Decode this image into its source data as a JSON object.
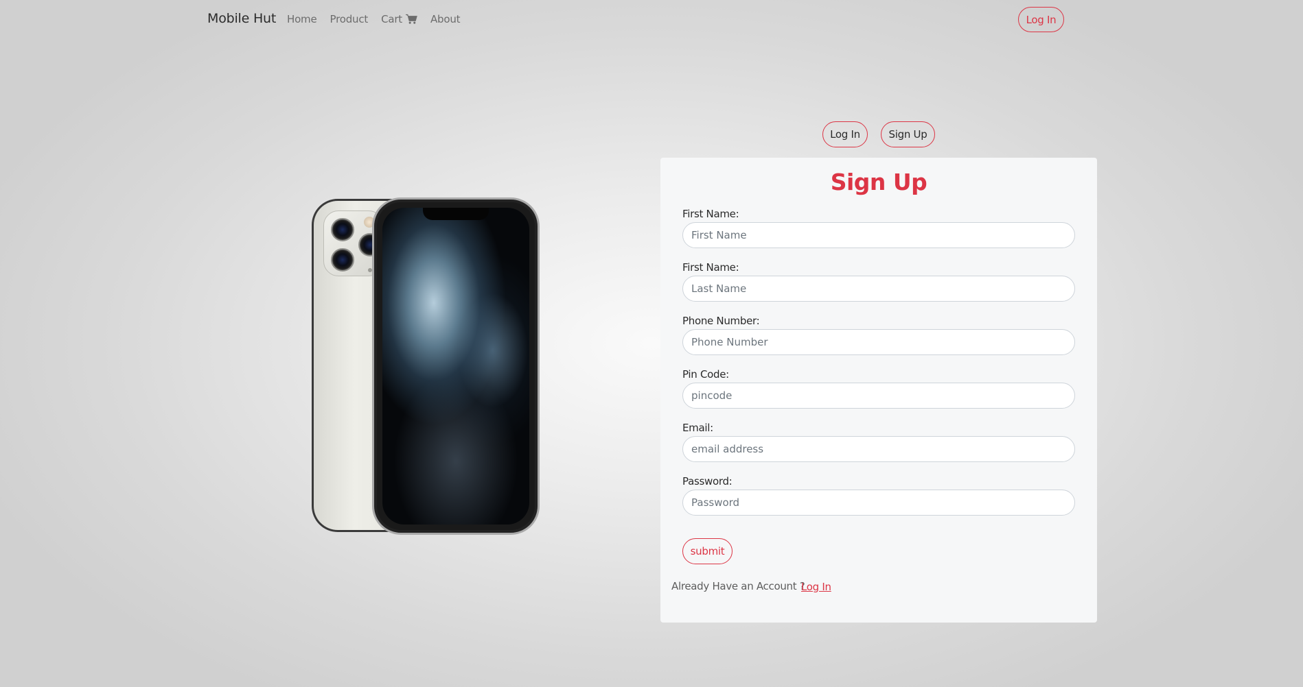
{
  "navbar": {
    "brand": "Mobile Hut",
    "links": [
      "Home",
      "Product",
      "Cart",
      "About"
    ],
    "login_label": "Log In"
  },
  "toggle": {
    "login_label": "Log In",
    "signup_label": "Sign Up"
  },
  "form": {
    "title": "Sign Up",
    "fields": [
      {
        "label": "First Name:",
        "placeholder": "First Name",
        "value": ""
      },
      {
        "label": "First Name:",
        "placeholder": "Last Name",
        "value": ""
      },
      {
        "label": "Phone Number:",
        "placeholder": "Phone Number",
        "value": ""
      },
      {
        "label": "Pin Code:",
        "placeholder": "pincode",
        "value": ""
      },
      {
        "label": "Email:",
        "placeholder": "email address",
        "value": ""
      },
      {
        "label": "Password:",
        "placeholder": "Password",
        "value": ""
      }
    ],
    "submit_label": "submit",
    "already_text": "Already Have an Account ?",
    "already_link": "Log In"
  },
  "colors": {
    "accent": "#dc3545",
    "card_bg": "#f6f7f8"
  },
  "icons": {
    "cart": "cart-icon"
  }
}
